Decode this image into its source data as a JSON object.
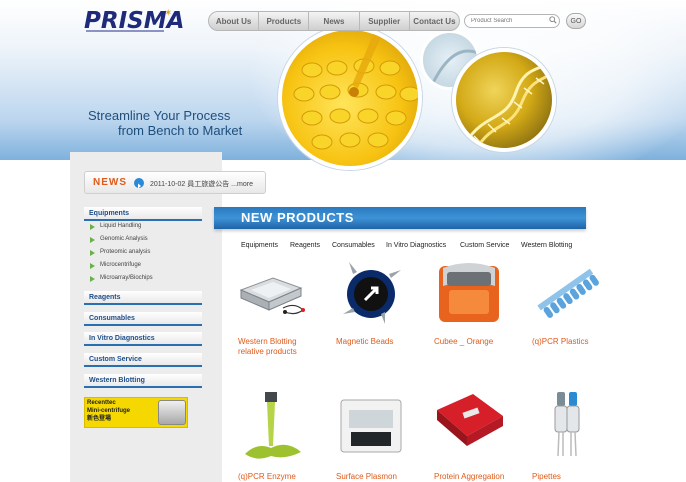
{
  "header": {
    "logo_text": "PRISMA",
    "nav": [
      {
        "label": "About Us"
      },
      {
        "label": "Products"
      },
      {
        "label": "News"
      },
      {
        "label": "Supplier"
      },
      {
        "label": "Contact Us"
      }
    ],
    "search_placeholder": "Product Search",
    "go_label": "GO"
  },
  "hero": {
    "tagline_line1": "Streamline Your Process",
    "tagline_line2": "from Bench to Market"
  },
  "news": {
    "label": "NEWS",
    "item_text": "2011-10-02 員工旅遊公告 ...more"
  },
  "sidebar": {
    "equipments": {
      "label": "Equipments",
      "items": [
        {
          "label": "Liquid Handling"
        },
        {
          "label": "Genomic Analysis"
        },
        {
          "label": "Proteomic analysis"
        },
        {
          "label": "Microcentrifuge"
        },
        {
          "label": "Microarray/Biochips"
        }
      ]
    },
    "categories": [
      {
        "label": "Reagents"
      },
      {
        "label": "Consumables"
      },
      {
        "label": "In Vitro Diagnostics"
      },
      {
        "label": "Custom Service"
      },
      {
        "label": "Western Blotting"
      }
    ],
    "promo": {
      "line1": "Recenttec",
      "line2": "Mini-centrifuge",
      "line3": "新色登場"
    }
  },
  "main": {
    "section_title": "NEW PRODUCTS",
    "tabs": [
      {
        "label": "Equipments"
      },
      {
        "label": "Reagents"
      },
      {
        "label": "Consumables"
      },
      {
        "label": "In Vitro Diagnostics"
      },
      {
        "label": "Custom Service"
      },
      {
        "label": "Western Blotting"
      }
    ],
    "products": [
      {
        "line1": "Western Blotting",
        "line2": "relative products",
        "icon": "blotting-apparatus-icon"
      },
      {
        "line1": "Magnetic Beads",
        "line2": "",
        "icon": "magnetic-beads-icon"
      },
      {
        "line1": "Cubee _ Orange",
        "line2": "",
        "icon": "cubee-device-icon"
      },
      {
        "line1": "(q)PCR Plastics",
        "line2": "",
        "icon": "pcr-strip-icon"
      },
      {
        "line1": "(q)PCR Enzyme",
        "line2": "",
        "icon": "pcr-enzyme-icon"
      },
      {
        "line1": "Surface Plasmon",
        "line2": "",
        "icon": "spr-instrument-icon"
      },
      {
        "line1": "Protein Aggregation",
        "line2": "",
        "icon": "protein-aggregation-icon"
      },
      {
        "line1": "Pipettes",
        "line2": "",
        "icon": "pipettes-icon"
      }
    ]
  },
  "colors": {
    "accent_blue": "#2a79bf",
    "accent_orange": "#e05a1a",
    "logo_navy": "#1f2a7a",
    "bullet_green": "#6bb14a"
  }
}
